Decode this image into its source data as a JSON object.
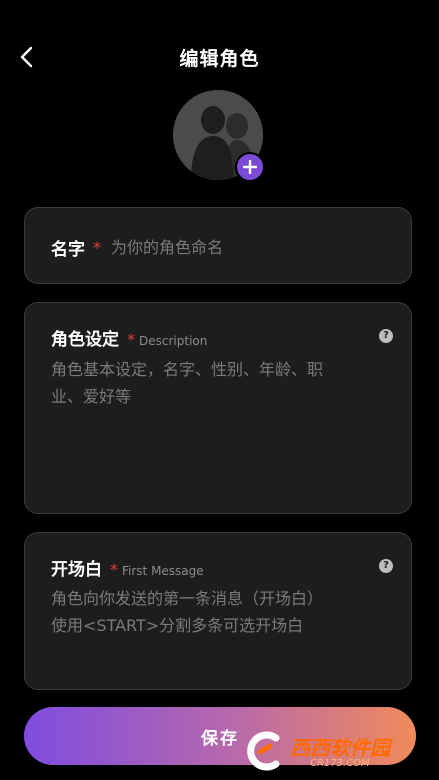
{
  "header": {
    "title": "编辑角色",
    "back_icon": "chevron-left-icon"
  },
  "avatar": {
    "add_icon": "plus-icon"
  },
  "name_field": {
    "label": "名字",
    "required_mark": "*",
    "placeholder": "为你的角色命名"
  },
  "description_field": {
    "label": "角色设定",
    "required_mark": "*",
    "sublabel": "Description",
    "placeholder_line1": "角色基本设定，名字、性别、年龄、职",
    "placeholder_line2": "业、爱好等",
    "help_icon": "question-icon"
  },
  "first_message_field": {
    "label": "开场白",
    "required_mark": "*",
    "sublabel": "First Message",
    "placeholder_line1": "角色向你发送的第一条消息（开场白）",
    "placeholder_line2": "使用<START>分割多条可选开场白",
    "help_icon": "question-icon"
  },
  "save_button": {
    "label": "保存"
  },
  "watermark": {
    "main": "西西软件园",
    "sub": "CR173.COM"
  },
  "colors": {
    "accent_purple": "#7b4bd6",
    "gradient_end": "#f08b5a",
    "required": "#e23d3d"
  }
}
